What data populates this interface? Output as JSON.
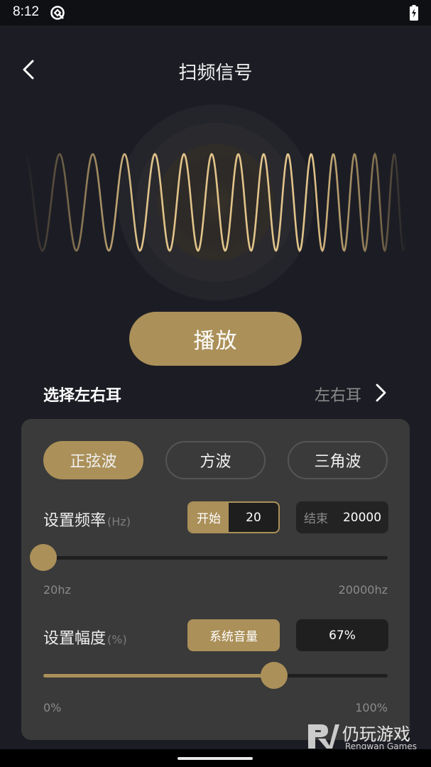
{
  "status_bar": {
    "time": "8:12"
  },
  "header": {
    "title": "扫频信号"
  },
  "play_button": {
    "label": "播放"
  },
  "ear_select": {
    "title": "选择左右耳",
    "value": "左右耳"
  },
  "wave_types": [
    {
      "label": "正弦波",
      "active": true
    },
    {
      "label": "方波",
      "active": false
    },
    {
      "label": "三角波",
      "active": false
    }
  ],
  "frequency": {
    "label": "设置频率",
    "unit": "(Hz)",
    "start_tag": "开始",
    "start_value": "20",
    "end_tag": "结束",
    "end_value": "20000",
    "min_label": "20hz",
    "max_label": "20000hz",
    "slider_level": 0
  },
  "amplitude": {
    "label": "设置幅度",
    "unit": "(%)",
    "system_volume_label": "系统音量",
    "value": "67%",
    "min_label": "0%",
    "max_label": "100%",
    "slider_level": 0.67
  },
  "watermark": {
    "brand_cn": "仍玩游戏",
    "brand_en": "Rengwan Games"
  },
  "colors": {
    "accent": "#ab9059",
    "background": "#1c1d24",
    "panel": "#3a3a3a"
  }
}
